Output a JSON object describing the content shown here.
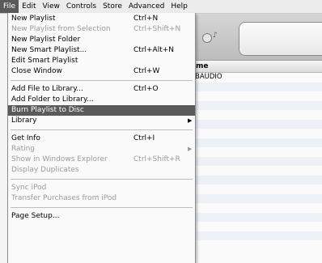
{
  "menubar": {
    "items": [
      {
        "label": "File"
      },
      {
        "label": "Edit"
      },
      {
        "label": "View"
      },
      {
        "label": "Controls"
      },
      {
        "label": "Store"
      },
      {
        "label": "Advanced"
      },
      {
        "label": "Help"
      }
    ]
  },
  "background": {
    "column_header": "me",
    "rows": [
      "BAUDIO",
      "",
      "",
      "",
      "",
      "",
      "",
      "",
      "",
      "",
      "",
      "",
      "",
      "",
      "",
      "",
      "",
      "",
      ""
    ]
  },
  "file_menu": {
    "new_playlist": {
      "label": "New Playlist",
      "shortcut": "Ctrl+N"
    },
    "new_playlist_from_selection": {
      "label": "New Playlist from Selection",
      "shortcut": "Ctrl+Shift+N"
    },
    "new_playlist_folder": {
      "label": "New Playlist Folder"
    },
    "new_smart_playlist": {
      "label": "New Smart Playlist...",
      "shortcut": "Ctrl+Alt+N"
    },
    "edit_smart_playlist": {
      "label": "Edit Smart Playlist"
    },
    "close_window": {
      "label": "Close Window",
      "shortcut": "Ctrl+W"
    },
    "add_file": {
      "label": "Add File to Library...",
      "shortcut": "Ctrl+O"
    },
    "add_folder": {
      "label": "Add Folder to Library..."
    },
    "burn_playlist": {
      "label": "Burn Playlist to Disc"
    },
    "library": {
      "label": "Library"
    },
    "get_info": {
      "label": "Get Info",
      "shortcut": "Ctrl+I"
    },
    "rating": {
      "label": "Rating"
    },
    "show_in_explorer": {
      "label": "Show in Windows Explorer",
      "shortcut": "Ctrl+Shift+R"
    },
    "display_duplicates": {
      "label": "Display Duplicates"
    },
    "sync_ipod": {
      "label": "Sync iPod"
    },
    "transfer_purchases": {
      "label": "Transfer Purchases from iPod"
    },
    "page_setup": {
      "label": "Page Setup..."
    }
  }
}
